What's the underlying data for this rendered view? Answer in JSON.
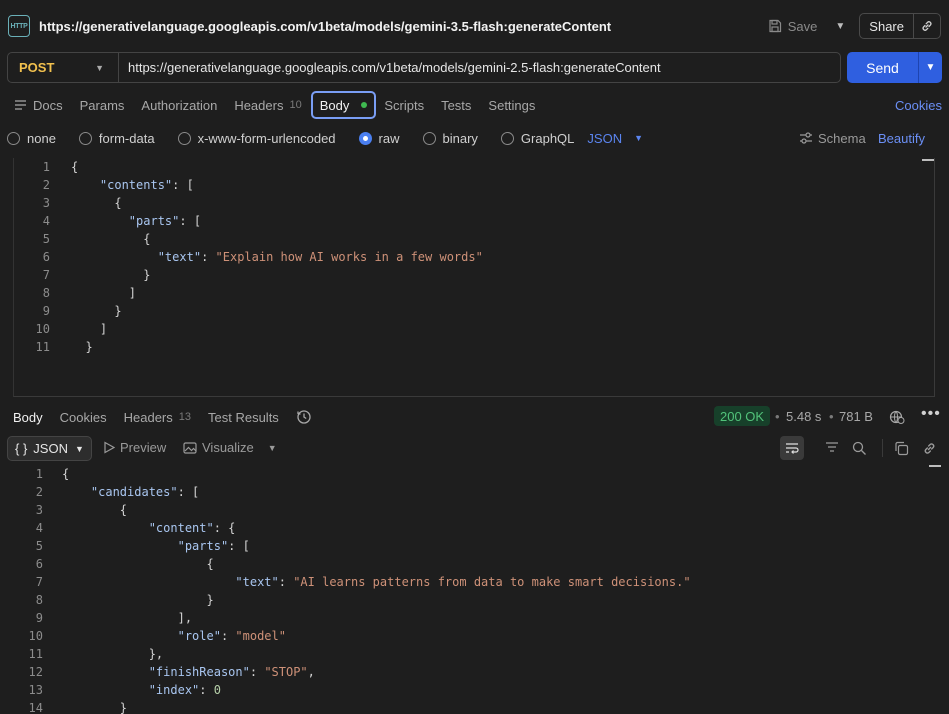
{
  "titlebar": {
    "badge": "HTTP",
    "title": "https://generativelanguage.googleapis.com/v1beta/models/gemini-3.5-flash:generateContent",
    "save_label": "Save",
    "share_label": "Share"
  },
  "request": {
    "method": "POST",
    "url": "https://generativelanguage.googleapis.com/v1beta/models/gemini-2.5-flash:generateContent",
    "send_label": "Send"
  },
  "req_tabs": {
    "docs": "Docs",
    "params": "Params",
    "authorization": "Authorization",
    "headers": "Headers",
    "headers_count": "10",
    "body": "Body",
    "scripts": "Scripts",
    "tests": "Tests",
    "settings": "Settings",
    "cookies": "Cookies"
  },
  "body_types": {
    "none": "none",
    "form_data": "form-data",
    "urlencoded": "x-www-form-urlencoded",
    "raw": "raw",
    "binary": "binary",
    "graphql": "GraphQL",
    "selected": "raw",
    "format": "JSON",
    "schema": "Schema",
    "beautify": "Beautify"
  },
  "request_body": [
    [
      [
        "p",
        "{"
      ]
    ],
    [
      [
        "p",
        "    "
      ],
      [
        "k",
        "\"contents\""
      ],
      [
        "p",
        ": ["
      ]
    ],
    [
      [
        "p",
        "      {"
      ]
    ],
    [
      [
        "p",
        "        "
      ],
      [
        "k",
        "\"parts\""
      ],
      [
        "p",
        ": ["
      ]
    ],
    [
      [
        "p",
        "          {"
      ]
    ],
    [
      [
        "p",
        "            "
      ],
      [
        "k",
        "\"text\""
      ],
      [
        "p",
        ": "
      ],
      [
        "s",
        "\"Explain how AI works in a few words\""
      ]
    ],
    [
      [
        "p",
        "          }"
      ]
    ],
    [
      [
        "p",
        "        ]"
      ]
    ],
    [
      [
        "p",
        "      }"
      ]
    ],
    [
      [
        "p",
        "    ]"
      ]
    ],
    [
      [
        "p",
        "  }"
      ]
    ]
  ],
  "response": {
    "tabs": {
      "body": "Body",
      "cookies": "Cookies",
      "headers": "Headers",
      "headers_count": "13",
      "test_results": "Test Results"
    },
    "status": "200 OK",
    "time": "5.48 s",
    "size": "781 B",
    "format": "JSON",
    "format_icon": "{ }",
    "preview": "Preview",
    "visualize": "Visualize"
  },
  "response_body": [
    [
      [
        "p",
        "{"
      ]
    ],
    [
      [
        "p",
        "    "
      ],
      [
        "k",
        "\"candidates\""
      ],
      [
        "p",
        ": ["
      ]
    ],
    [
      [
        "p",
        "        {"
      ]
    ],
    [
      [
        "p",
        "            "
      ],
      [
        "k",
        "\"content\""
      ],
      [
        "p",
        ": {"
      ]
    ],
    [
      [
        "p",
        "                "
      ],
      [
        "k",
        "\"parts\""
      ],
      [
        "p",
        ": ["
      ]
    ],
    [
      [
        "p",
        "                    {"
      ]
    ],
    [
      [
        "p",
        "                        "
      ],
      [
        "k",
        "\"text\""
      ],
      [
        "p",
        ": "
      ],
      [
        "s",
        "\"AI learns patterns from data to make smart decisions.\""
      ]
    ],
    [
      [
        "p",
        "                    }"
      ]
    ],
    [
      [
        "p",
        "                ],"
      ]
    ],
    [
      [
        "p",
        "                "
      ],
      [
        "k",
        "\"role\""
      ],
      [
        "p",
        ": "
      ],
      [
        "s",
        "\"model\""
      ]
    ],
    [
      [
        "p",
        "            },"
      ]
    ],
    [
      [
        "p",
        "            "
      ],
      [
        "k",
        "\"finishReason\""
      ],
      [
        "p",
        ": "
      ],
      [
        "s",
        "\"STOP\""
      ],
      [
        "p",
        ","
      ]
    ],
    [
      [
        "p",
        "            "
      ],
      [
        "k",
        "\"index\""
      ],
      [
        "p",
        ": "
      ],
      [
        "n",
        "0"
      ]
    ],
    [
      [
        "p",
        "        }"
      ]
    ]
  ],
  "colors": {
    "accent": "#2f5fe0",
    "link": "#6b8ff5",
    "method": "#f2c14e",
    "status_ok": "#52c27a"
  }
}
